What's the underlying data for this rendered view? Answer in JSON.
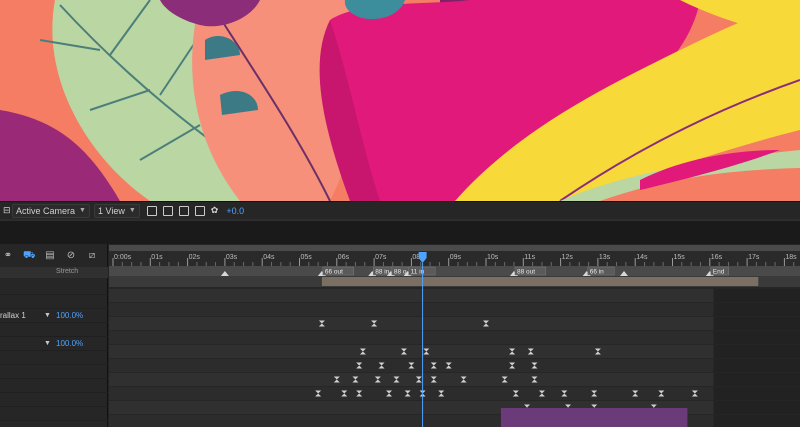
{
  "viewer_toolbar": {
    "camera": "Active Camera",
    "views": "1 View",
    "exposure": "+0.0"
  },
  "layer_panel": {
    "stretch_header": "Stretch",
    "layer_name": "rallax 1",
    "layer_value": "100.0%",
    "second_value": "100.0%"
  },
  "time_ruler": {
    "labels": [
      "0:00s",
      "01s",
      "02s",
      "03s",
      "04s",
      "05s",
      "06s",
      "07s",
      "08s",
      "09s",
      "10s",
      "11s",
      "12s",
      "13s",
      "14s",
      "15s",
      "16s",
      "17s",
      "18s"
    ]
  },
  "markers": [
    {
      "label": "66 out",
      "time": 5.6
    },
    {
      "label": "88 in",
      "time": 6.95
    },
    {
      "label": "88 o",
      "time": 7.45
    },
    {
      "label": "11 in",
      "time": 7.9
    },
    {
      "label": "88 out",
      "time": 10.75
    },
    {
      "label": "66 in",
      "time": 12.7
    },
    {
      "label": "End",
      "time": 16.0
    }
  ],
  "playhead_time": 8.3,
  "colors": {
    "accent": "#4fa3ff",
    "magenta": "#e0197b",
    "purple_bar": "#6b3a78",
    "work_area": "#7a6f62"
  }
}
